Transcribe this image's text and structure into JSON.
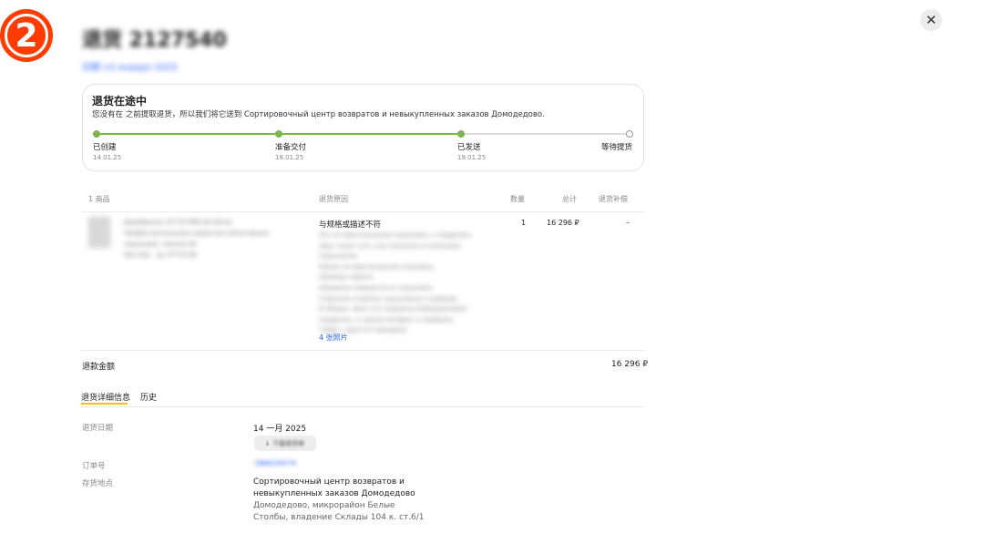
{
  "badge": {
    "number": "2",
    "color": "#ff3b00"
  },
  "header": {
    "title": "退货 2127540",
    "subtitle": "日期 14 января 2025"
  },
  "close_icon": "close-icon",
  "status": {
    "title": "退货在途中",
    "description": "您没有在 之前提取退货，所以我们将它送到 Сортировочный центр возвратов и невыкупленных заказов Домодедово.",
    "accent_color": "#7ab648",
    "steps": [
      {
        "label": "已创建",
        "date": "14.01.25",
        "done": true
      },
      {
        "label": "准备交付",
        "date": "18.01.25",
        "done": true
      },
      {
        "label": "已发送",
        "date": "19.01.25",
        "done": true
      },
      {
        "label": "等待提货",
        "date": "",
        "done": false
      }
    ]
  },
  "table": {
    "headers": {
      "product": "1 商品",
      "reason": "退货原因",
      "qty": "数量",
      "total": "总计",
      "compensation": "退货补偿"
    },
    "row": {
      "product_lines": [
        "Баребрахон ST770 PRO 80 Ohms",
        "Профессиональные закрытые мониторные",
        "наушники, черные 80",
        "SKU 001 · by ST770 80"
      ],
      "reason": "与规格或描述不符",
      "comment_lines": [
        "Это не оригинальные наушники, а подделка.",
        "Звук тише того, как написано в описании",
        "наушников.",
        "Кроме не оригинальная упаковка,",
        "провода короче.",
        "Неровная поверхность наушника.",
        "Странная отделка наушников и провода.",
        "В общем, явно это подделка Бэйердинамик",
        "подделка, я сделал возврат и проверку",
        "товар с другого продавца."
      ],
      "photos_link": "4 张照片",
      "qty": "1",
      "total": "16 296 ₽",
      "compensation": "–"
    }
  },
  "refund": {
    "label": "退款金额",
    "value": "16 296 ₽"
  },
  "tabs": [
    {
      "label": "退货详细信息",
      "active": true
    },
    {
      "label": "历史",
      "active": false
    }
  ],
  "details": {
    "date_label": "退货日期",
    "date_value": "14 一月 2025",
    "download_label": "下载退货单",
    "order_label": "订单号",
    "order_value": "286635474",
    "location_label": "存货地点",
    "location_name_1": "Сортировочный центр возвратов и",
    "location_name_2": "невыкупленных заказов Домодедово",
    "location_addr_1": "Домодедово, микрорайон Белые",
    "location_addr_2": "Столбы, владение Склады 104 к. ст.6/1"
  }
}
